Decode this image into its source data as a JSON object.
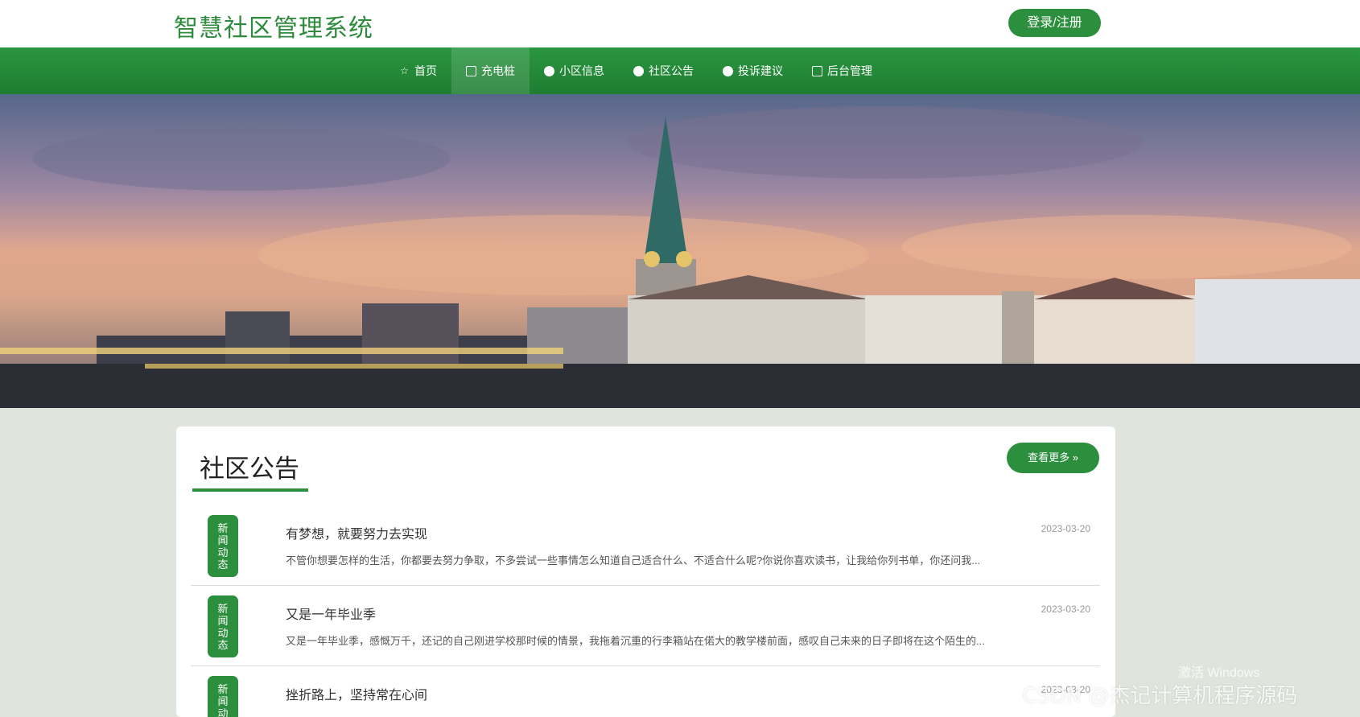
{
  "header": {
    "site_title": "智慧社区管理系统",
    "login_label": "登录/注册"
  },
  "nav": {
    "items": [
      {
        "label": "首页",
        "icon": "star-icon"
      },
      {
        "label": "充电桩",
        "icon": "bag-icon"
      },
      {
        "label": "小区信息",
        "icon": "dot-icon"
      },
      {
        "label": "社区公告",
        "icon": "dot-icon"
      },
      {
        "label": "投诉建议",
        "icon": "info-icon"
      },
      {
        "label": "后台管理",
        "icon": "clipboard-icon"
      }
    ],
    "active_index": 1
  },
  "notice": {
    "title": "社区公告",
    "more_label": "查看更多 »",
    "badge_chars": [
      "新",
      "闻",
      "动",
      "态"
    ],
    "items": [
      {
        "title": "有梦想，就要努力去实现",
        "date": "2023-03-20",
        "summary": "不管你想要怎样的生活，你都要去努力争取，不多尝试一些事情怎么知道自己适合什么、不适合什么呢?你说你喜欢读书，让我给你列书单，你还问我..."
      },
      {
        "title": "又是一年毕业季",
        "date": "2023-03-20",
        "summary": "又是一年毕业季，感慨万千，还记的自己刚进学校那时候的情景，我拖着沉重的行李箱站在偌大的教学楼前面，感叹自己未来的日子即将在这个陌生的..."
      },
      {
        "title": "挫折路上，坚持常在心间",
        "date": "2023-03-20",
        "summary": ""
      }
    ]
  },
  "watermark": "CSDN @杰记计算机程序源码",
  "os_watermark": "激活 Windows"
}
